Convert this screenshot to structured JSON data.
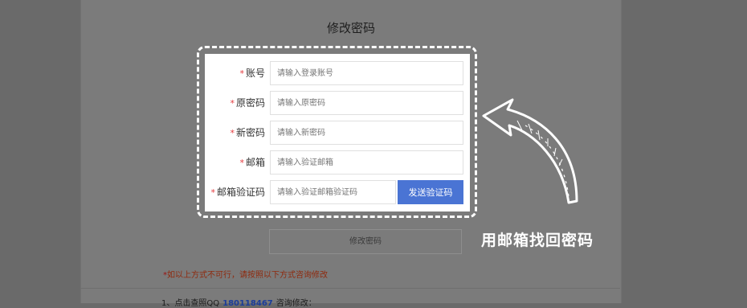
{
  "page": {
    "title": "修改密码"
  },
  "form": {
    "required_mark": "*",
    "fields": [
      {
        "label": "账号",
        "placeholder": "请输入登录账号"
      },
      {
        "label": "原密码",
        "placeholder": "请输入原密码"
      },
      {
        "label": "新密码",
        "placeholder": "请输入新密码"
      },
      {
        "label": "邮箱",
        "placeholder": "请输入验证邮箱"
      },
      {
        "label": "邮箱验证码",
        "placeholder": "请输入验证邮箱验证码"
      }
    ],
    "send_code_button": "发送验证码",
    "submit_button": "修改密码"
  },
  "notice": {
    "mark": "*",
    "text": "如以上方式不可行，请按照以下方式咨询修改"
  },
  "contact": {
    "prefix": "1、点击查照QQ",
    "qq": "180118467",
    "suffix": "咨询修改："
  },
  "annotation": {
    "text": "用邮箱找回密码"
  },
  "colors": {
    "accent": "#4a74d4",
    "required": "#e4393c",
    "notice": "#8f2a0e"
  }
}
